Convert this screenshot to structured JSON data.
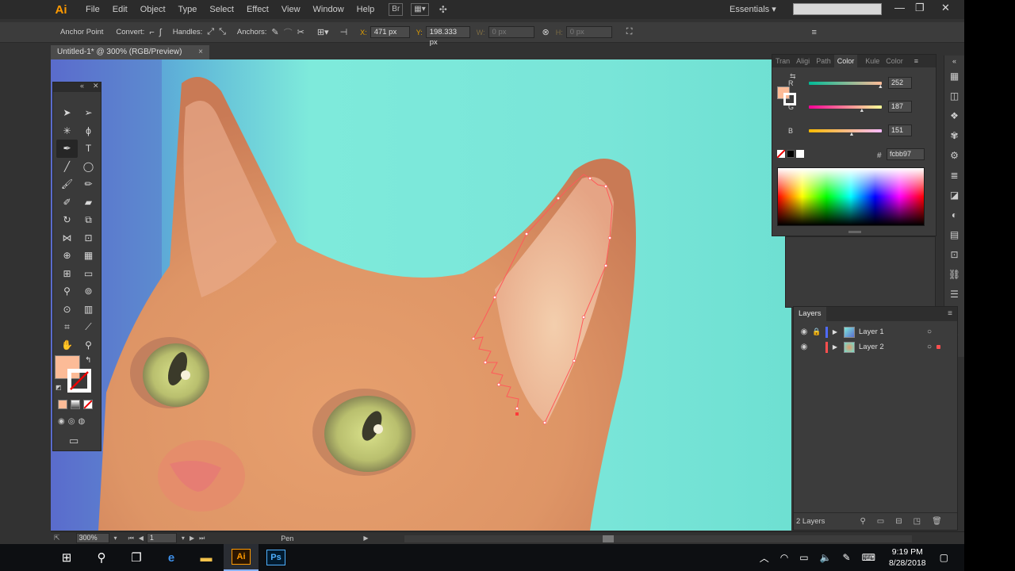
{
  "menubar": {
    "logo": "Ai",
    "items": [
      "File",
      "Edit",
      "Object",
      "Type",
      "Select",
      "Effect",
      "View",
      "Window",
      "Help"
    ],
    "bridge_label": "Br",
    "workspace": "Essentials"
  },
  "controlbar": {
    "anchor_point": "Anchor Point",
    "convert": "Convert:",
    "handles": "Handles:",
    "anchors": "Anchors:",
    "x_label": "X:",
    "x_value": "471 px",
    "y_label": "Y:",
    "y_value": "198.333 px",
    "w_label": "W:",
    "w_value": "0 px",
    "h_label": "H:",
    "h_value": "0 px"
  },
  "document": {
    "tab_title": "Untitled-1* @ 300% (RGB/Preview)"
  },
  "color_panel": {
    "tabs": [
      "Tran",
      "Aligi",
      "Path",
      "Color",
      "Kule",
      "Color"
    ],
    "active_tab": "Color",
    "r_label": "R",
    "g_label": "G",
    "b_label": "B",
    "r_value": "252",
    "g_value": "187",
    "b_value": "151",
    "r_fraction": 0.988,
    "g_fraction": 0.733,
    "b_fraction": 0.592,
    "hex_symbol": "#",
    "hex": "fcbb97",
    "fill_color": "#fcbb97"
  },
  "layers_panel": {
    "tab": "Layers",
    "layers": [
      {
        "name": "Layer 1",
        "color": "#4f6bff"
      },
      {
        "name": "Layer 2",
        "color": "#ff4f4f"
      }
    ],
    "count": "2 Layers"
  },
  "statusbar": {
    "zoom": "300%",
    "artboard": "1",
    "tool": "Pen"
  },
  "taskbar": {
    "ai_app": "Ai",
    "ps_app": "Ps",
    "time": "9:19 PM",
    "date": "8/28/2018"
  }
}
